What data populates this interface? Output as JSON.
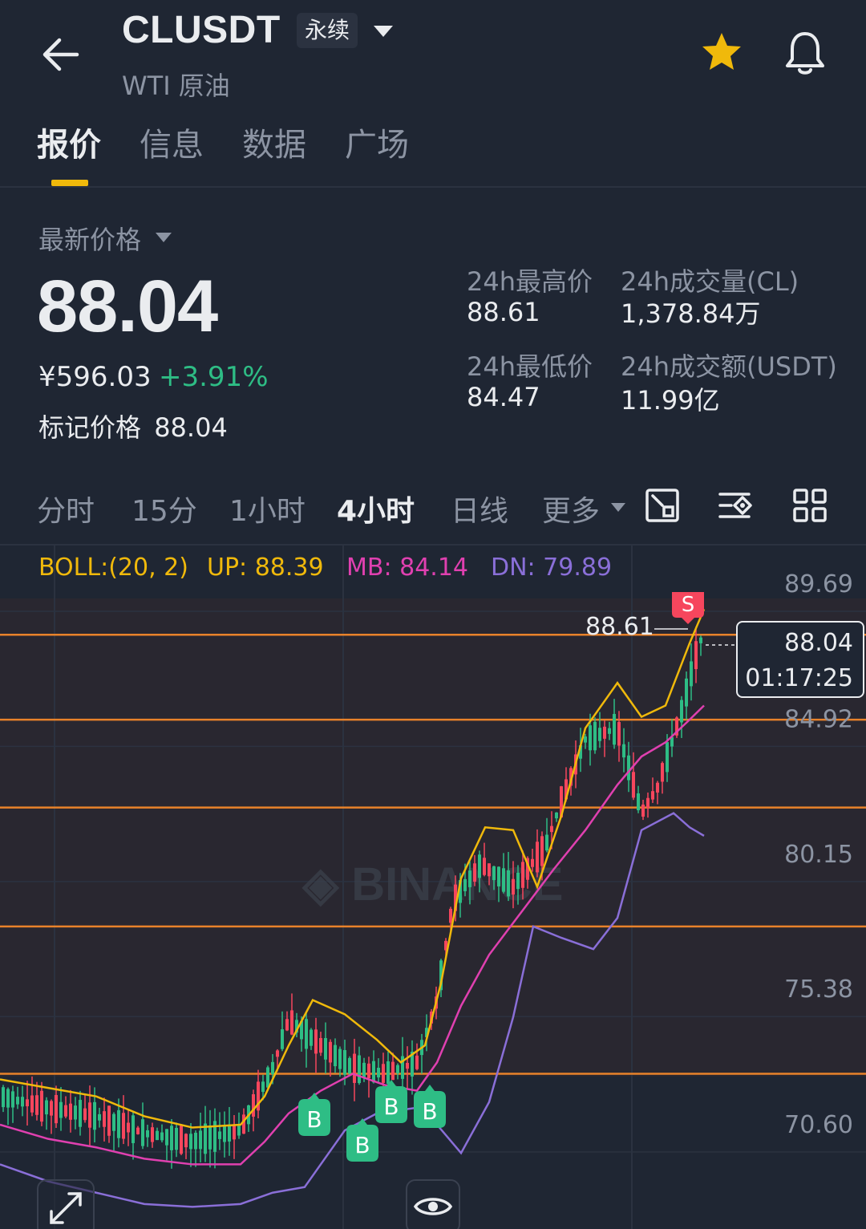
{
  "header": {
    "symbol": "CLUSDT",
    "contract_type": "永续",
    "subtitle": "WTI 原油",
    "icons": [
      "back-arrow-icon",
      "chevron-down-icon",
      "star-icon",
      "bell-icon"
    ]
  },
  "tabs": [
    {
      "label": "报价",
      "active": true
    },
    {
      "label": "信息",
      "active": false
    },
    {
      "label": "数据",
      "active": false
    },
    {
      "label": "广场",
      "active": false
    }
  ],
  "price": {
    "last_label": "最新价格",
    "last": "88.04",
    "cny": "¥596.03",
    "change": "+3.91%",
    "mark_label": "标记价格",
    "mark_value": "88.04"
  },
  "stats": {
    "high_label": "24h最高价",
    "high": "88.61",
    "low_label": "24h最低价",
    "low": "84.47",
    "vol_label": "24h成交量(CL)",
    "vol": "1,378.84万",
    "turnover_label": "24h成交额(USDT)",
    "turnover": "11.99亿"
  },
  "timeframes": [
    {
      "label": "分时",
      "active": false
    },
    {
      "label": "15分",
      "active": false
    },
    {
      "label": "1小时",
      "active": false
    },
    {
      "label": "4小时",
      "active": true
    },
    {
      "label": "日线",
      "active": false
    },
    {
      "label": "更多",
      "active": false
    }
  ],
  "toolbar_icons": [
    "chart-draw-icon",
    "indicator-settings-icon",
    "grid-layout-icon"
  ],
  "boll": {
    "label": "BOLL:(20, 2)",
    "up": "UP: 88.39",
    "mb": "MB: 84.14",
    "dn": "DN: 79.89"
  },
  "chart": {
    "axis_labels": [
      "89.69",
      "84.92",
      "80.15",
      "75.38",
      "70.60"
    ],
    "high_marker": "88.61",
    "current_price": "88.04",
    "countdown": "01:17:25",
    "watermark": "BINANCE",
    "buy_marker": "B",
    "sell_marker": "S"
  },
  "colors": {
    "background": "#1f2633",
    "up": "#2ebd85",
    "down": "#f6465d",
    "accent": "#f0b90b",
    "boll_up": "#f0b90b",
    "boll_mb": "#e040b0",
    "boll_dn": "#8a6fd8",
    "level_line": "#e8822a"
  },
  "chart_data": {
    "type": "candlestick",
    "interval": "4小时",
    "yaxis_ticks": [
      89.69,
      84.92,
      80.15,
      75.38,
      70.6
    ],
    "high": 88.61,
    "last": 88.04,
    "boll": {
      "period": 20,
      "k": 2,
      "up": 88.39,
      "mb": 84.14,
      "dn": 79.89
    },
    "horizontal_levels": [
      87.9,
      84.9,
      81.8,
      77.6,
      72.4
    ],
    "markers": [
      {
        "type": "B",
        "index": 20
      },
      {
        "type": "B",
        "index": 23
      },
      {
        "type": "B",
        "index": 26
      },
      {
        "type": "B",
        "index": 28
      },
      {
        "type": "S",
        "index": 46
      }
    ]
  }
}
